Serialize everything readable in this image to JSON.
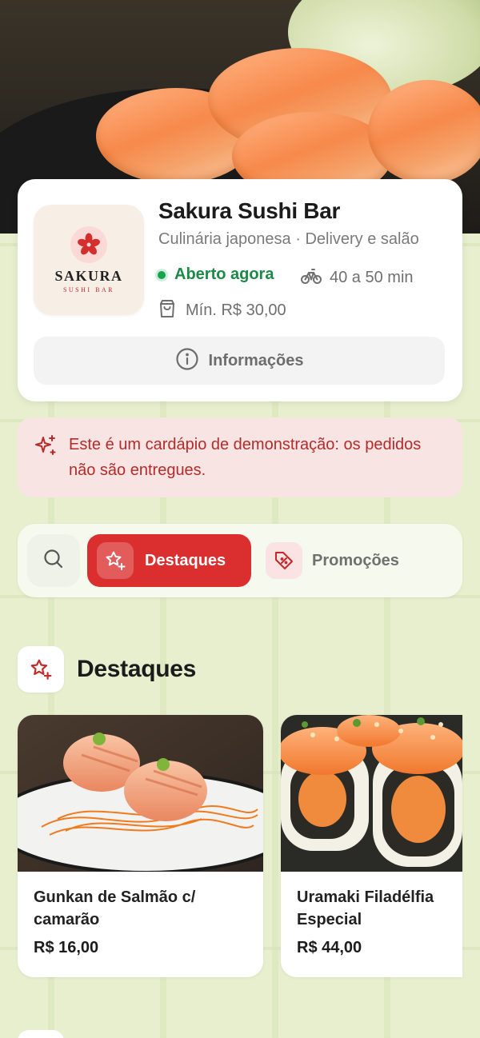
{
  "restaurant": {
    "name": "Sakura Sushi Bar",
    "cuisine": "Culinária japonesa · Delivery e salão",
    "status": "Aberto agora",
    "delivery_time": "40 a 50 min",
    "minimum": "Mín. R$ 30,00",
    "logo_name": "SAKURA",
    "logo_sub": "SUSHI BAR",
    "info_button": "Informações"
  },
  "banner": {
    "text": "Este é um cardápio de demonstração: os pedidos não são entregues."
  },
  "tabs": {
    "search_icon": "search-icon",
    "items": [
      {
        "label": "Destaques",
        "icon": "star-sparkle-icon",
        "active": true
      },
      {
        "label": "Promoções",
        "icon": "tag-percent-icon",
        "active": false
      }
    ]
  },
  "section": {
    "title": "Destaques",
    "icon": "star-sparkle-icon"
  },
  "products": [
    {
      "name": "Gunkan de Salmão c/ camarão",
      "price": "R$ 16,00"
    },
    {
      "name": "Uramaki Filadélfia Especial",
      "price": "R$ 44,00"
    }
  ],
  "colors": {
    "accent": "#db2f2f",
    "open_status": "#1a8a46",
    "background": "#e7efcf",
    "banner_bg": "#f8e4e2"
  }
}
